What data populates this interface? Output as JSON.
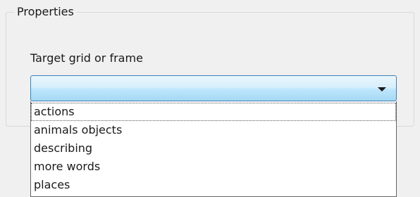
{
  "properties": {
    "group_title": "Properties",
    "target_label": "Target grid or frame",
    "target_combo": {
      "value": "",
      "options": [
        "actions",
        "animals objects",
        "describing",
        "more words",
        "places"
      ],
      "focused_option": "actions",
      "expanded": true,
      "arrow_icon": "dropdown-arrow-icon"
    }
  }
}
